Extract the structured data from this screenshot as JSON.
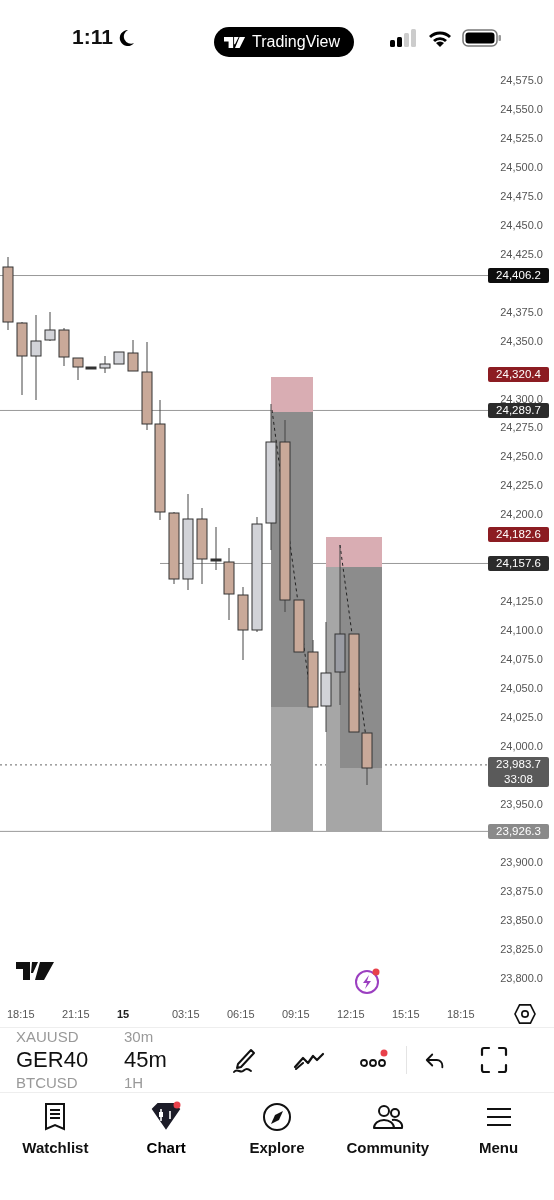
{
  "status_bar": {
    "time": "1:11",
    "app_pill": "TradingView"
  },
  "price_axis": {
    "labels": [
      "24,575.0",
      "24,550.0",
      "24,525.0",
      "24,500.0",
      "24,475.0",
      "24,450.0",
      "24,425.0",
      "24,375.0",
      "24,350.0",
      "24,300.0",
      "24,275.0",
      "24,250.0",
      "24,225.0",
      "24,200.0",
      "24,125.0",
      "24,100.0",
      "24,075.0",
      "24,050.0",
      "24,025.0",
      "24,000.0",
      "23,950.0",
      "23,900.0",
      "23,875.0",
      "23,850.0",
      "23,825.0",
      "23,800.0"
    ]
  },
  "price_tags": [
    {
      "price": "24,406.2",
      "color": "#0d0d0d",
      "kind": "solid"
    },
    {
      "price": "24,320.4",
      "color": "#8c1c22",
      "kind": "none"
    },
    {
      "price": "24,289.7",
      "color": "#2b2b2b",
      "kind": "solid"
    },
    {
      "price": "24,182.6",
      "color": "#8c1c22",
      "kind": "none"
    },
    {
      "price": "24,157.6",
      "color": "#2b2b2b",
      "kind": "partial"
    },
    {
      "price": "23,983.7",
      "color": "#5a5a5a",
      "kind": "dotted",
      "countdown": "33:08"
    },
    {
      "price": "23,926.3",
      "color": "#8a8a8a",
      "kind": "solid"
    }
  ],
  "alerts_badge": true,
  "time_axis": [
    {
      "label": "18:15",
      "bold": false
    },
    {
      "label": "21:15",
      "bold": false
    },
    {
      "label": "15",
      "bold": true
    },
    {
      "label": "03:15",
      "bold": false
    },
    {
      "label": "06:15",
      "bold": false
    },
    {
      "label": "09:15",
      "bold": false
    },
    {
      "label": "12:15",
      "bold": false
    },
    {
      "label": "15:15",
      "bold": false
    },
    {
      "label": "18:15",
      "bold": false
    }
  ],
  "toolbar": {
    "symbols": [
      {
        "label": "XAUUSD",
        "selected": false
      },
      {
        "label": "GER40",
        "selected": true
      },
      {
        "label": "BTCUSD",
        "selected": false
      }
    ],
    "intervals": [
      {
        "label": "30m",
        "selected": false
      },
      {
        "label": "45m",
        "selected": true
      },
      {
        "label": "1H",
        "selected": false
      }
    ],
    "more_badge": true
  },
  "nav": [
    {
      "label": "Watchlist",
      "kind": "watchlist",
      "selected": false,
      "badge": false
    },
    {
      "label": "Chart",
      "kind": "chart",
      "selected": true,
      "badge": true
    },
    {
      "label": "Explore",
      "kind": "explore",
      "selected": false,
      "badge": false
    },
    {
      "label": "Community",
      "kind": "community",
      "selected": false,
      "badge": false
    },
    {
      "label": "Menu",
      "kind": "menu",
      "selected": false,
      "badge": false
    }
  ]
}
